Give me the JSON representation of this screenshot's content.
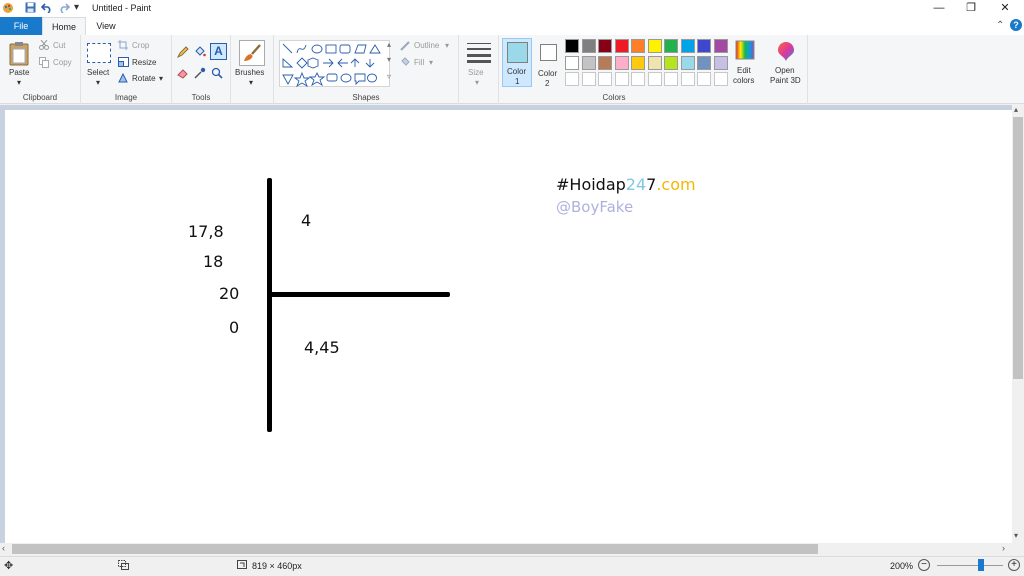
{
  "window": {
    "title": "Untitled - Paint",
    "colors": {
      "file_tab": "#1979ca",
      "selected_tool": "#cde8ff"
    }
  },
  "quick_access": [
    "paint-app-icon",
    "save-icon",
    "undo-icon",
    "redo-icon",
    "customize-dropdown-icon"
  ],
  "tabs": {
    "file": "File",
    "home": "Home",
    "view": "View"
  },
  "ribbon": {
    "clipboard": {
      "label": "Clipboard",
      "paste": "Paste",
      "cut": "Cut",
      "copy": "Copy"
    },
    "image": {
      "label": "Image",
      "select": "Select",
      "crop": "Crop",
      "resize": "Resize",
      "rotate": "Rotate"
    },
    "tools": {
      "label": "Tools"
    },
    "brushes": {
      "label": "Brushes"
    },
    "shapes": {
      "label": "Shapes",
      "outline": "Outline",
      "fill": "Fill"
    },
    "size": {
      "label": "Size"
    },
    "colors": {
      "label": "Colors",
      "color1": "Color\n1",
      "color1_label_a": "Color",
      "color1_label_b": "1",
      "color2_label_a": "Color",
      "color2_label_b": "2",
      "color1_value": "#99d9ea",
      "color2_value": "#ffffff",
      "edit_a": "Edit",
      "edit_b": "colors",
      "palette_row1": [
        "#000000",
        "#7f7f7f",
        "#880015",
        "#ed1c24",
        "#ff7f27",
        "#fff200",
        "#22b14c",
        "#00a2e8",
        "#3f48cc",
        "#a349a4"
      ],
      "palette_row2": [
        "#ffffff",
        "#c3c3c3",
        "#b97a57",
        "#ffaec9",
        "#ffc90e",
        "#efe4b0",
        "#b5e61d",
        "#99d9ea",
        "#7092be",
        "#c8bfe7"
      ],
      "palette_row3": [
        "#ffffff",
        "#ffffff",
        "#ffffff",
        "#ffffff",
        "#ffffff",
        "#ffffff",
        "#ffffff",
        "#ffffff",
        "#ffffff",
        "#ffffff"
      ]
    },
    "paint3d": {
      "a": "Open",
      "b": "Paint 3D"
    }
  },
  "canvas": {
    "left_numbers": [
      "17,8",
      "18",
      "20",
      "0"
    ],
    "top_right": "4",
    "quotient": "4,45",
    "watermark": {
      "part1": "#Hoidap",
      "part2": "24",
      "part3": "7",
      "part4": ".com",
      "handle": "@BoyFake",
      "colors": {
        "part1": "#111111",
        "part2": "#7ec8e3",
        "part3": "#111111",
        "part4": "#f5b800",
        "handle": "#b0b0e0"
      }
    }
  },
  "status": {
    "dimensions": "819 × 460px",
    "zoom": "200%",
    "zoom_level_percent": 200
  }
}
